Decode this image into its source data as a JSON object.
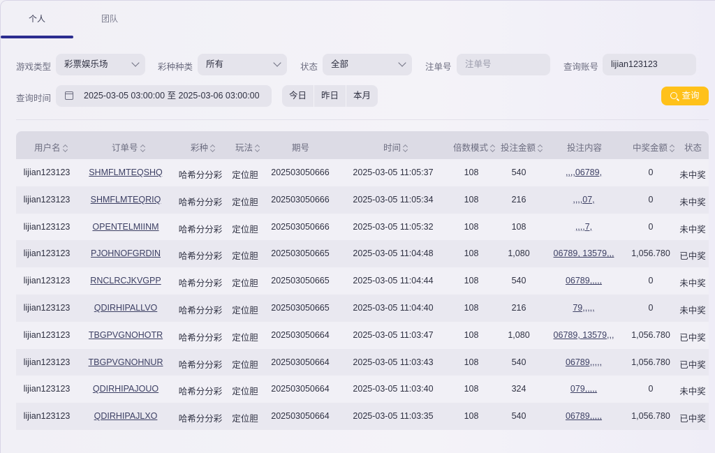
{
  "tabs": [
    {
      "label": "个人",
      "active": true
    },
    {
      "label": "团队",
      "active": false
    }
  ],
  "filters": {
    "game_type_label": "游戏类型",
    "game_type_value": "彩票娱乐场",
    "lottery_kind_label": "彩种种类",
    "lottery_kind_value": "所有",
    "status_label": "状态",
    "status_value": "全部",
    "order_no_label": "注单号",
    "order_no_placeholder": "注单号",
    "account_label": "查询账号",
    "account_value": "lijian123123",
    "time_label": "查询时间",
    "time_range": "2025-03-05 03:00:00 至 2025-03-06 03:00:00",
    "quick": [
      "今日",
      "昨日",
      "本月"
    ],
    "search_button": "查询"
  },
  "table": {
    "columns": [
      "用户名",
      "订单号",
      "彩种",
      "玩法",
      "期号",
      "时间",
      "倍数模式",
      "投注金额",
      "投注内容",
      "中奖金额",
      "状态"
    ],
    "rows": [
      {
        "user": "lijian123123",
        "order": "SHMFLMTEQSHQ",
        "lottery": "哈希分分彩",
        "play": "定位胆",
        "issue": "202503050666",
        "time": "2025-03-05 11:05:37",
        "multiple": "108",
        "amount": "540",
        "content": ",,,,06789,",
        "win": "0",
        "status": "未中奖"
      },
      {
        "user": "lijian123123",
        "order": "SHMFLMTEQRIQ",
        "lottery": "哈希分分彩",
        "play": "定位胆",
        "issue": "202503050666",
        "time": "2025-03-05 11:05:34",
        "multiple": "108",
        "amount": "216",
        "content": ",,,,07,",
        "win": "0",
        "status": "未中奖"
      },
      {
        "user": "lijian123123",
        "order": "OPENTELMIINM",
        "lottery": "哈希分分彩",
        "play": "定位胆",
        "issue": "202503050666",
        "time": "2025-03-05 11:05:32",
        "multiple": "108",
        "amount": "108",
        "content": ",,,,7,",
        "win": "0",
        "status": "未中奖"
      },
      {
        "user": "lijian123123",
        "order": "PJOHNOFGRDIN",
        "lottery": "哈希分分彩",
        "play": "定位胆",
        "issue": "202503050665",
        "time": "2025-03-05 11:04:48",
        "multiple": "108",
        "amount": "1,080",
        "content": "06789, 13579,,,",
        "win": "1,056.780",
        "status": "已中奖"
      },
      {
        "user": "lijian123123",
        "order": "RNCLRCJKVGPP",
        "lottery": "哈希分分彩",
        "play": "定位胆",
        "issue": "202503050665",
        "time": "2025-03-05 11:04:44",
        "multiple": "108",
        "amount": "540",
        "content": "06789,,,,,",
        "win": "0",
        "status": "未中奖"
      },
      {
        "user": "lijian123123",
        "order": "QDIRHIPALLVO",
        "lottery": "哈希分分彩",
        "play": "定位胆",
        "issue": "202503050665",
        "time": "2025-03-05 11:04:40",
        "multiple": "108",
        "amount": "216",
        "content": "79,,,,,",
        "win": "0",
        "status": "未中奖"
      },
      {
        "user": "lijian123123",
        "order": "TBGPVGNOHOTR",
        "lottery": "哈希分分彩",
        "play": "定位胆",
        "issue": "202503050664",
        "time": "2025-03-05 11:03:47",
        "multiple": "108",
        "amount": "1,080",
        "content": "06789, 13579,,,",
        "win": "1,056.780",
        "status": "已中奖"
      },
      {
        "user": "lijian123123",
        "order": "TBGPVGNOHNUR",
        "lottery": "哈希分分彩",
        "play": "定位胆",
        "issue": "202503050664",
        "time": "2025-03-05 11:03:43",
        "multiple": "108",
        "amount": "540",
        "content": "06789,,,,,",
        "win": "1,056.780",
        "status": "已中奖"
      },
      {
        "user": "lijian123123",
        "order": "QDIRHIPAJOUO",
        "lottery": "哈希分分彩",
        "play": "定位胆",
        "issue": "202503050664",
        "time": "2025-03-05 11:03:40",
        "multiple": "108",
        "amount": "324",
        "content": "079,,,,,",
        "win": "0",
        "status": "未中奖"
      },
      {
        "user": "lijian123123",
        "order": "QDIRHIPAJLXO",
        "lottery": "哈希分分彩",
        "play": "定位胆",
        "issue": "202503050664",
        "time": "2025-03-05 11:03:35",
        "multiple": "108",
        "amount": "540",
        "content": "06789,,,,,",
        "win": "1,056.780",
        "status": "已中奖"
      }
    ]
  },
  "colors": {
    "accent": "#2c2d8f",
    "search_button": "#ffc11a",
    "header_bg": "#dcdbe5"
  },
  "icons": {
    "calendar": "calendar-icon",
    "search": "search-icon",
    "dropdown": "chevron-down-icon",
    "sort": "sort-icon"
  }
}
